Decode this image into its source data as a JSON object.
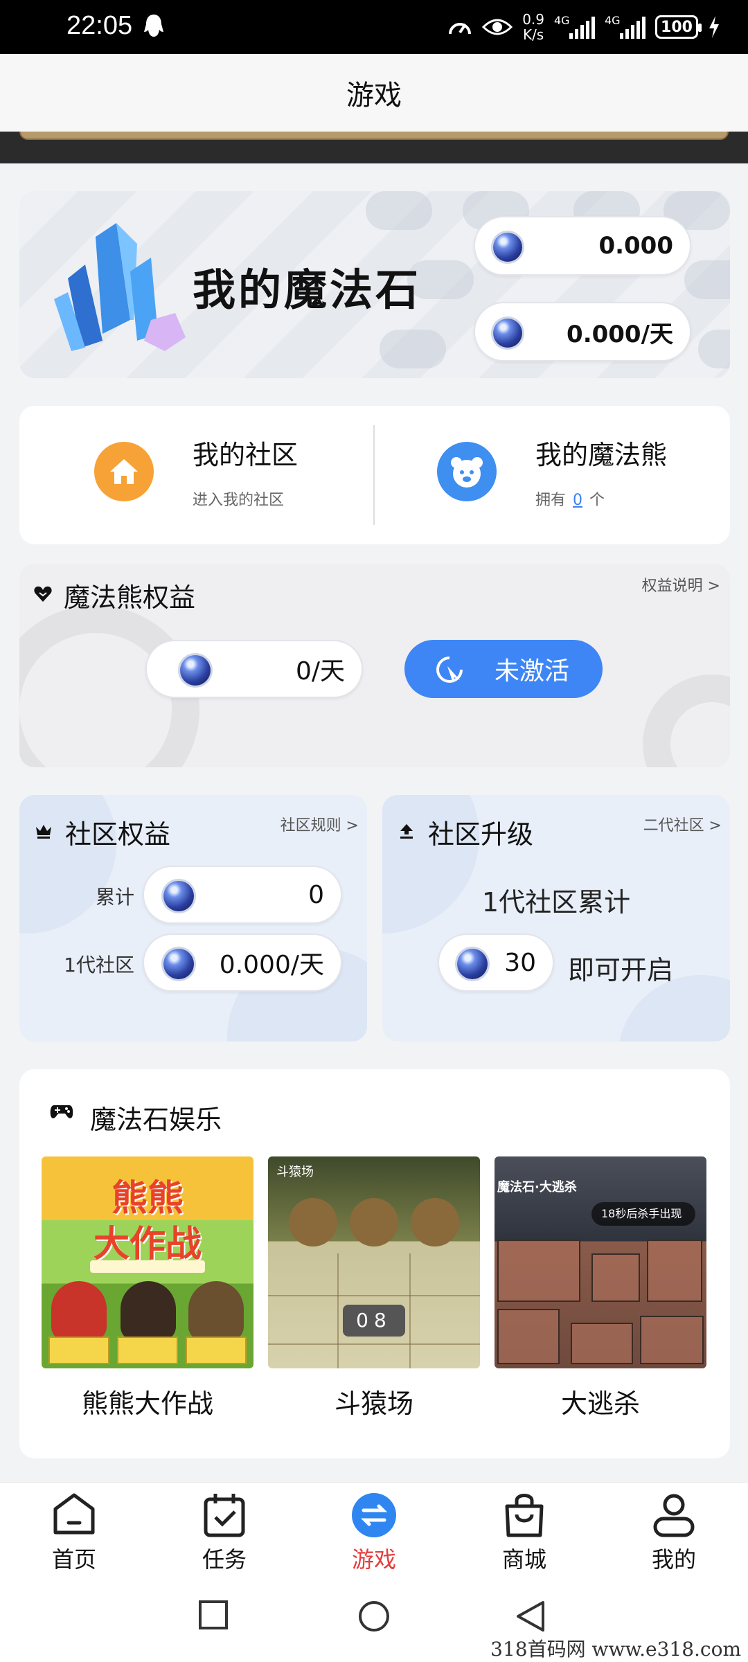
{
  "status_bar": {
    "time": "22:05",
    "speed_value": "0.9",
    "speed_unit": "K/s",
    "signal1_label": "4G",
    "signal2_label": "4G",
    "battery": "100"
  },
  "header": {
    "title": "游戏"
  },
  "magic_stone": {
    "title": "我的魔法石",
    "balance": "0.000",
    "daily_rate": "0.000/天"
  },
  "community": {
    "my_community": {
      "title": "我的社区",
      "subtitle": "进入我的社区"
    },
    "my_bears": {
      "title": "我的魔法熊",
      "own_prefix": "拥有",
      "count": "0",
      "unit": "个"
    }
  },
  "bear_rights": {
    "title": "魔法熊权益",
    "explain_link": "权益说明 >",
    "rate": "0/天",
    "activate_label": "未激活"
  },
  "community_rights": {
    "title": "社区权益",
    "rules_link": "社区规则 >",
    "total_label": "累计",
    "total_value": "0",
    "gen1_label": "1代社区",
    "gen1_value": "0.000/天"
  },
  "community_upgrade": {
    "title": "社区升级",
    "link": "二代社区 >",
    "line1": "1代社区累计",
    "required": "30",
    "suffix": "即可开启"
  },
  "entertainment": {
    "title": "魔法石娱乐",
    "games": [
      {
        "name": "熊熊大作战",
        "art_title_1": "熊熊",
        "art_title_2": "大作战"
      },
      {
        "name": "斗猿场",
        "art_header": "斗猿场",
        "clock": "08"
      },
      {
        "name": "大逃杀",
        "art_header": "魔法石·大逃杀",
        "banner": "18秒后杀手出现"
      }
    ]
  },
  "bottom_nav": {
    "items": [
      {
        "label": "首页"
      },
      {
        "label": "任务"
      },
      {
        "label": "游戏"
      },
      {
        "label": "商城"
      },
      {
        "label": "我的"
      }
    ],
    "active_color": "#e63c3c"
  },
  "watermark": "318首码网   www.e318.com"
}
